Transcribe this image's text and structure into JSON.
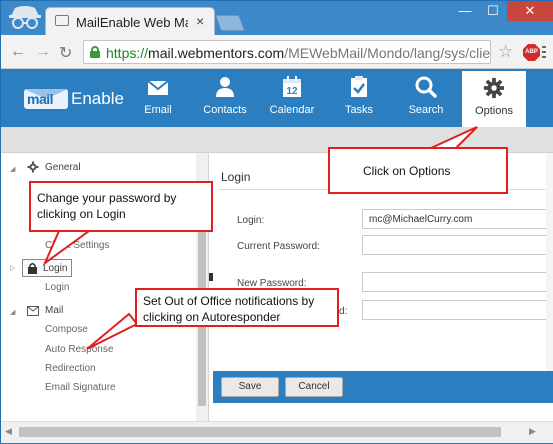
{
  "browser": {
    "tab_title": "MailEnable Web Mail",
    "tab_close": "×",
    "win_min": "—",
    "win_max": "☐",
    "win_close": "✕",
    "url_proto": "https://",
    "url_host": "mail.webmentors.com",
    "url_path": "/MEWebMail/Mondo/lang/sys/clien",
    "abp_label": "ABP"
  },
  "app": {
    "logo_mail": "mail",
    "logo_enable": "Enable",
    "nav": [
      {
        "label": "Email",
        "icon": "envelope-icon"
      },
      {
        "label": "Contacts",
        "icon": "person-icon"
      },
      {
        "label": "Calendar",
        "icon": "calendar-icon",
        "day": "12"
      },
      {
        "label": "Tasks",
        "icon": "clipboard-check-icon"
      },
      {
        "label": "Search",
        "icon": "magnifier-icon"
      },
      {
        "label": "Options",
        "icon": "gear-icon"
      }
    ],
    "active_nav": "Options"
  },
  "sidebar": {
    "general": "General",
    "client_settings": "Client Settings",
    "login": "Login",
    "login_sub": "Login",
    "mail": "Mail",
    "compose": "Compose",
    "auto_response": "Auto Response",
    "redirection": "Redirection",
    "email_signature": "Email Signature"
  },
  "main": {
    "title": "Login",
    "login_label": "Login:",
    "login_value": "mc@MichaelCurry.com",
    "current_password_label": "Current Password:",
    "new_password_label": "New Password:",
    "confirm_password_label": "d:",
    "save": "Save",
    "cancel": "Cancel"
  },
  "callouts": {
    "options": "Click on Options",
    "password": "Change your password by clicking on Login",
    "autoresponder": "Set Out of Office notifications by clicking on Autoresponder"
  },
  "colors": {
    "brand_blue": "#2b7fc0",
    "callout_red": "#e02020"
  }
}
